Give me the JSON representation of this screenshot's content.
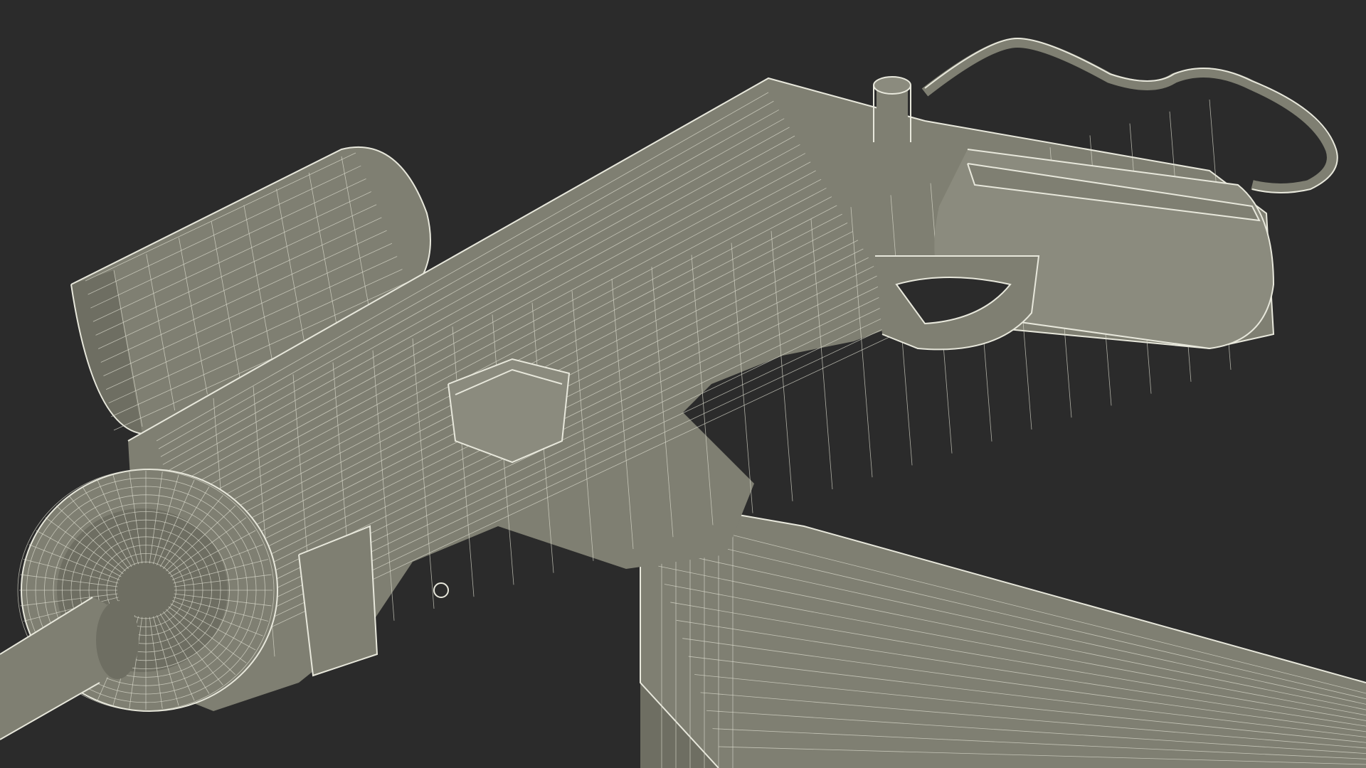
{
  "scene": {
    "subject": "wireframe-3d-model",
    "background_color": "#2b2b2b",
    "surface_color": "#7f7f72",
    "wire_color": "#e8e8dc"
  }
}
